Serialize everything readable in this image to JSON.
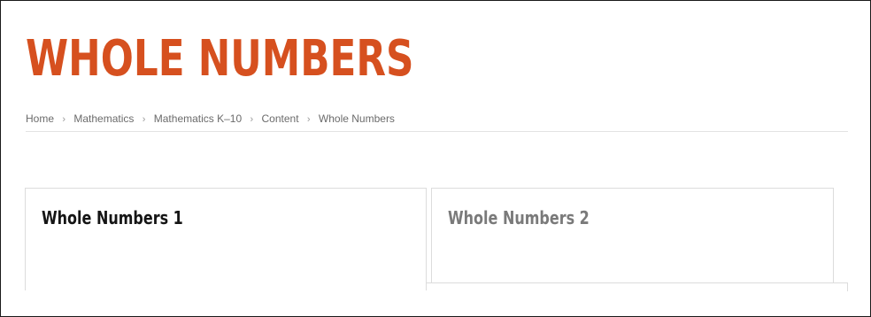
{
  "page": {
    "title": "WHOLE NUMBERS"
  },
  "breadcrumb": {
    "items": [
      "Home",
      "Mathematics",
      "Mathematics K–10",
      "Content",
      "Whole Numbers"
    ],
    "separator": "›"
  },
  "tabs": [
    {
      "label": "Whole Numbers 1",
      "active": true
    },
    {
      "label": "Whole Numbers 2",
      "active": false
    }
  ],
  "colors": {
    "title": "#d6501f",
    "breadcrumb_text": "#6b6b6b",
    "active_tab_text": "#151515",
    "inactive_tab_text": "#7a7a7a",
    "border": "#dcdcdc"
  }
}
